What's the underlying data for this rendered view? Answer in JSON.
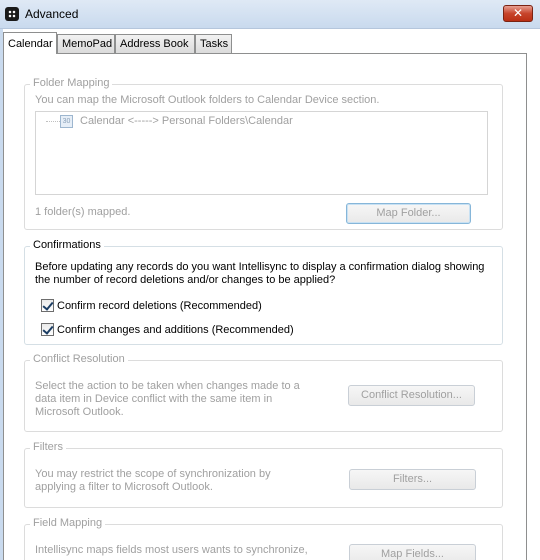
{
  "window": {
    "title": "Advanced",
    "close_label": "✕"
  },
  "tabs": [
    {
      "label": "Calendar",
      "active": true
    },
    {
      "label": "MemoPad",
      "active": false
    },
    {
      "label": "Address Book",
      "active": false
    },
    {
      "label": "Tasks",
      "active": false
    }
  ],
  "folder_mapping": {
    "title": "Folder Mapping",
    "description": "You can map the Microsoft Outlook folders to Calendar Device section.",
    "mapping_item": "Calendar <-----> Personal Folders\\Calendar",
    "icon_text": "30",
    "status": "1 folder(s) mapped.",
    "button_label": "Map Folder..."
  },
  "confirmations": {
    "title": "Confirmations",
    "description_line1": "Before updating any records do you want Intellisync to display a confirmation dialog showing",
    "description_line2": "the number of record deletions and/or changes to be applied?",
    "checkbox1": {
      "label": "Confirm record deletions (Recommended)",
      "checked": true
    },
    "checkbox2": {
      "label": "Confirm changes and additions (Recommended)",
      "checked": true
    }
  },
  "conflict_resolution": {
    "title": "Conflict Resolution",
    "line1": "Select the action to be taken when changes made to a",
    "line2": "data item in Device conflict with the same item in",
    "line3": "Microsoft Outlook.",
    "button_label": "Conflict Resolution..."
  },
  "filters": {
    "title": "Filters",
    "line1": "You may restrict the scope of synchronization by",
    "line2": "applying a filter to Microsoft Outlook.",
    "button_label": "Filters..."
  },
  "field_mapping": {
    "title": "Field Mapping",
    "line1": "Intellisync maps fields most users wants to synchronize,",
    "button_label": "Map Fields..."
  }
}
